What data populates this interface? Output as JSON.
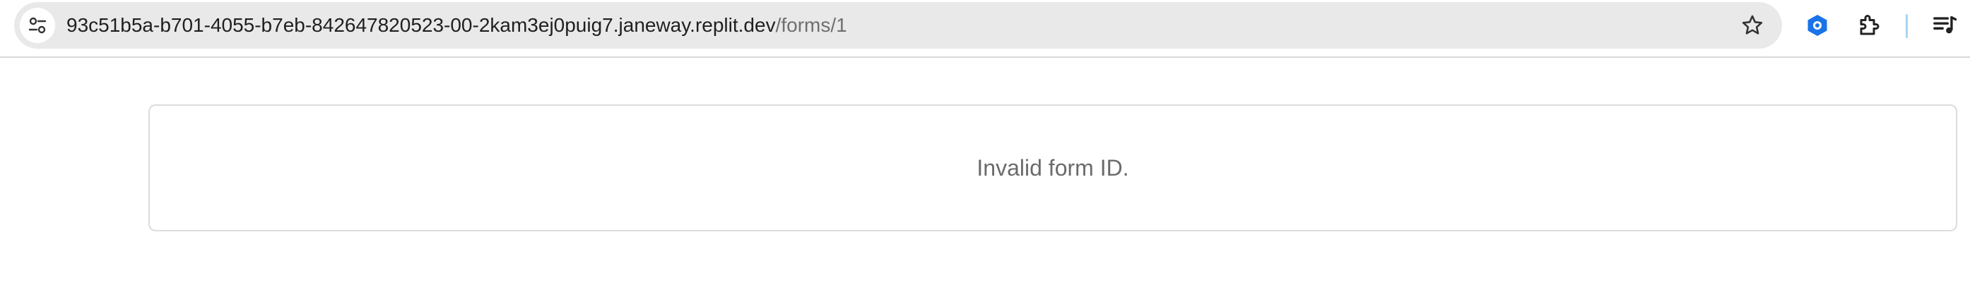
{
  "browser": {
    "url_host": "93c51b5a-b701-4055-b7eb-842647820523-00-2kam3ej0puig7.janeway.replit.dev",
    "url_path": "/forms/1",
    "icons": {
      "site_info": "tune-icon",
      "bookmark": "star-icon",
      "extension_1": "tag-icon",
      "extensions": "puzzle-icon",
      "menu": "playlist-icon"
    },
    "accent_color": "#1a73e8"
  },
  "page": {
    "message": "Invalid form ID."
  }
}
